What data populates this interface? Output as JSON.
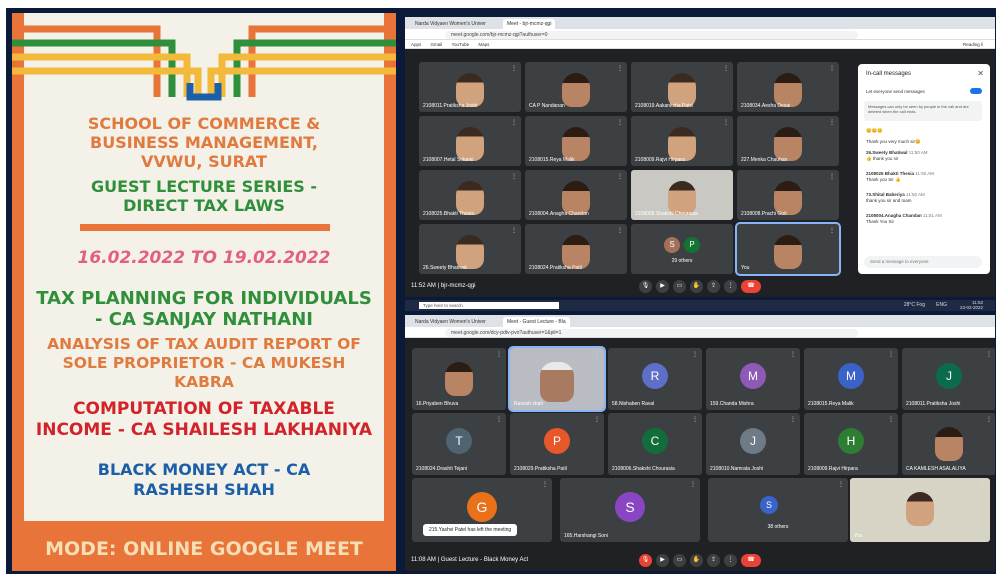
{
  "poster": {
    "school_line1": "SCHOOL OF COMMERCE &",
    "school_line2": "BUSINESS MANAGEMENT,",
    "school_line3": "VVWU, SURAT",
    "series_line1": "GUEST LECTURE SERIES -",
    "series_line2": "DIRECT TAX LAWS",
    "dates": "16.02.2022 TO 19.02.2022",
    "topic1_line1": "TAX PLANNING FOR INDIVIDUALS",
    "topic1_line2": "- CA SANJAY NATHANI",
    "topic2_line1": "ANALYSIS OF TAX AUDIT REPORT OF",
    "topic2_line2": "SOLE PROPRIETOR - CA MUKESH",
    "topic2_line3": "KABRA",
    "topic3_line1": "COMPUTATION OF TAXABLE",
    "topic3_line2": "INCOME - CA SHAILESH LAKHANIYA",
    "topic4_line1": "BLACK MONEY ACT - CA",
    "topic4_line2": "RASHESH SHAH",
    "mode": "MODE: ONLINE GOOGLE MEET",
    "colors": {
      "orange": "#e07a3e",
      "green": "#2f8f3a",
      "red": "#d2232a",
      "blue": "#1b5fa8"
    }
  },
  "meet1": {
    "tab1": "Narda Vidyaen Women's Univer",
    "tab2": "Meet - bjr-mcmz-qgi",
    "url": "meet.google.com/bjr-mcmz-qgi?authuser=0",
    "bookmarks": [
      "Apps",
      "Gmail",
      "YouTube",
      "Maps"
    ],
    "reading_list": "Reading li",
    "tiles": [
      {
        "name": "2108011.Pratiksha Joshi"
      },
      {
        "name": "CA P Nandanan"
      },
      {
        "name": "2108019.Aakanksha Patel"
      },
      {
        "name": "2108034.Aesha Desai"
      },
      {
        "name": "2108007.Hetal Solanki"
      },
      {
        "name": "2108015.Reya Malik"
      },
      {
        "name": "2108009.Rajvi Hirpara"
      },
      {
        "name": "227.Menka Chauhan"
      },
      {
        "name": "2108025.Bhakti Thesia"
      },
      {
        "name": "2108004.Anagha Chandan"
      },
      {
        "name": "2108006.Shakshi Chourasia"
      },
      {
        "name": "2108008.Prachi Goti"
      },
      {
        "name": "26.Sweety Bhatiwal"
      },
      {
        "name": "2108024.Pratiksha Patil"
      },
      {
        "name": "29 others",
        "avatars": [
          "S",
          "P"
        ]
      },
      {
        "name": "You"
      }
    ],
    "time": "11:52 AM",
    "meeting_code": "bjr-mcmz-qgi",
    "chat": {
      "title": "In-call messages",
      "toggle_label": "Let everyone send messages",
      "info": "Messages can only be seen by people in the call and are deleted when the call ends.",
      "messages": [
        {
          "author": "",
          "time": "",
          "text": "😊😊😊"
        },
        {
          "author": "",
          "time": "",
          "text": "Thank you very much sir😊"
        },
        {
          "author": "26.Sweety Bhatiwal",
          "time": "11:50 AM",
          "text": "👍 thank you sir"
        },
        {
          "author": "2108025 Bhakti Thesia",
          "time": "11:50 AM",
          "text": "Thank you Sir 👍"
        },
        {
          "author": "73.Shital Baberiya",
          "time": "11:50 AM",
          "text": "thank you sir and mam"
        },
        {
          "author": "2108004.Anagha Chandan",
          "time": "11:51 AM",
          "text": "Thank You Sir"
        }
      ],
      "input_placeholder": "Send a message to everyone"
    }
  },
  "taskbar": {
    "search": "Type here to search",
    "weather": "28°C Fog",
    "lang": "ENG",
    "time": "11:52",
    "date": "23-02-2022"
  },
  "meet2": {
    "tab1": "Narda Vidyaen Women's Univer",
    "tab2": "Meet - Guest Lecture - Bla",
    "url": "meet.google.com/dcy-pdtv-pvo?authuser=1&pli=1",
    "tiles": [
      {
        "name": "16.Priyaben Bhuva"
      },
      {
        "name": "Rasesh shah"
      },
      {
        "name": "58.Nishaben Raval",
        "letter": "R",
        "color": "#5f6ec7"
      },
      {
        "name": "159.Chanda Mishra",
        "letter": "M",
        "color": "#8e5ab6"
      },
      {
        "name": "2108015.Reya Malik",
        "letter": "M",
        "color": "#3b62c9"
      },
      {
        "name": "2108011.Pratiksha Joshi",
        "letter": "J",
        "color": "#0b6b4f"
      },
      {
        "name": "2108024.Drashti Tejani",
        "letter": "T",
        "color": "#4f6371"
      },
      {
        "name": "2108029.Pratiksha Patil",
        "letter": "P",
        "color": "#e8572a"
      },
      {
        "name": "2108006.Shakshi Chourasia",
        "letter": "C",
        "color": "#136d3a"
      },
      {
        "name": "2108010.Namrata Joshi",
        "letter": "J",
        "color": "#6e7b86"
      },
      {
        "name": "2108009.Rajvi Hirpara",
        "letter": "H",
        "color": "#2f7d32"
      },
      {
        "name": "CA KAMLESH ASALALIYA"
      },
      {
        "name": "",
        "letter": "G",
        "color": "#e8711a"
      },
      {
        "name": "165.Harshangi Soni",
        "letter": "S",
        "color": "#8a46c2"
      },
      {
        "name": "38 others",
        "letter": "S",
        "color": "#3b62c9"
      },
      {
        "name": "You"
      }
    ],
    "toast": "215.Yashvi Patel has left the meeting",
    "time": "11:08 AM",
    "meeting_title": "Guest Lecture - Black Money Act"
  }
}
